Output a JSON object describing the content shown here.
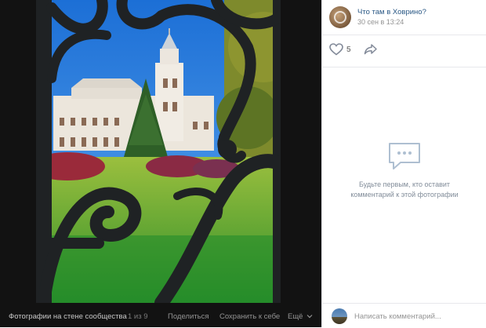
{
  "viewer": {
    "album_label": "Фотографии на стене сообщества",
    "counter": "1 из 9",
    "share_label": "Поделиться",
    "save_label": "Сохранить к себе",
    "more_label": "Ещё"
  },
  "post": {
    "author_name": "Что там в Ховрино?",
    "date": "30 сен в 13:24",
    "likes": "5",
    "empty_comments_line1": "Будьте первым, кто оставит",
    "empty_comments_line2": "комментарий к этой фотографии"
  },
  "composer": {
    "placeholder": "Написать комментарий..."
  },
  "icons": {
    "like": "heart-outline-icon",
    "share": "share-arrow-icon",
    "comments": "speech-bubble-icon",
    "more": "chevron-down-icon"
  },
  "colors": {
    "link": "#2a5885",
    "muted": "#939393",
    "viewer_bg": "#121212",
    "divider": "#e7e8ec"
  }
}
